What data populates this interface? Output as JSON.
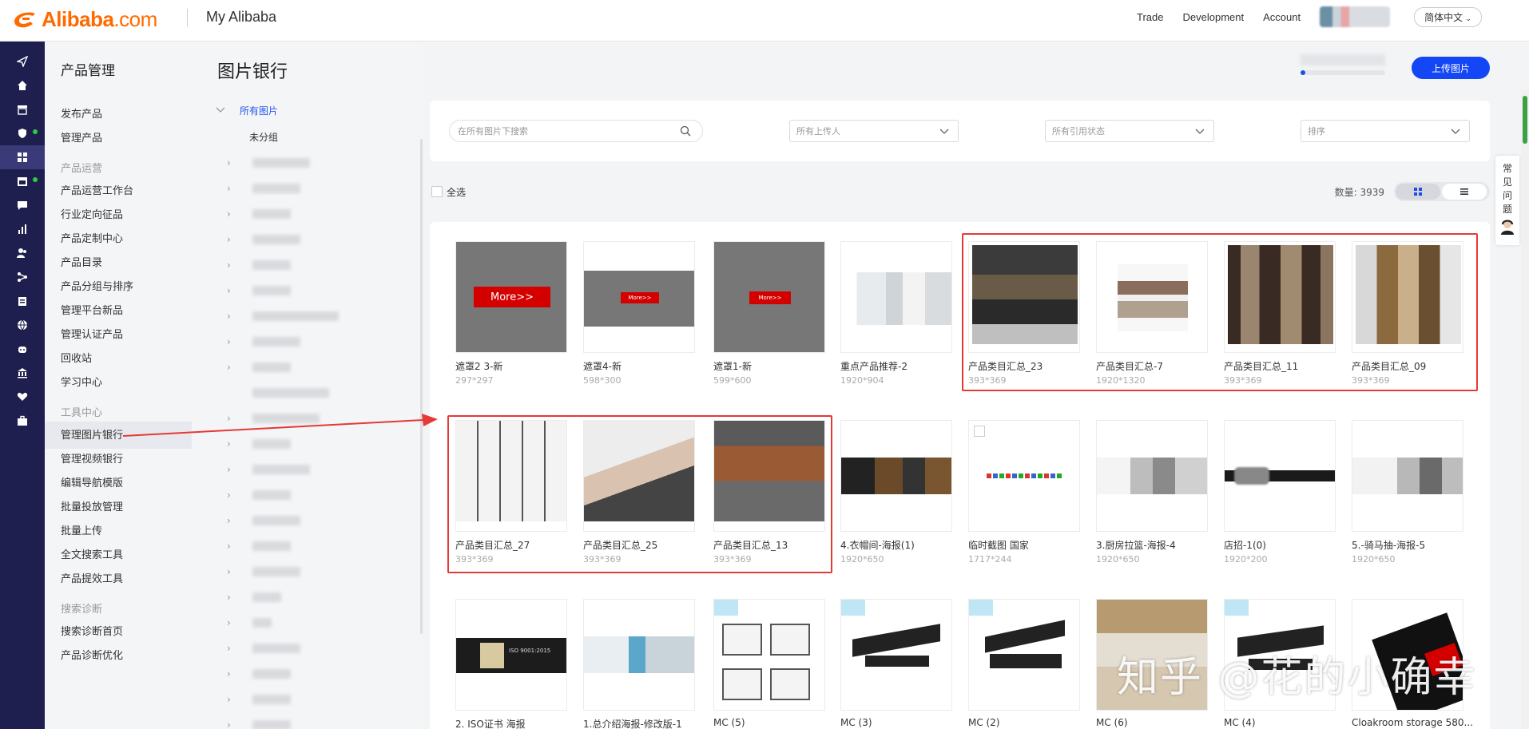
{
  "header": {
    "logo_text": "Alibaba",
    "logo_suffix": ".com",
    "app_title": "My Alibaba",
    "nav": [
      "Trade",
      "Development",
      "Account"
    ],
    "language": "简体中文"
  },
  "rail_icons": [
    "send-icon",
    "home-icon",
    "store-icon",
    "shield-icon",
    "grid-icon",
    "calendar-icon",
    "chat-icon",
    "chart-icon",
    "users-icon",
    "flow-icon",
    "clipboard-icon",
    "globe-icon",
    "robot-icon",
    "bank-icon",
    "heart-icon",
    "briefcase-icon"
  ],
  "sidebar": {
    "title": "产品管理",
    "items1": [
      "发布产品",
      "管理产品"
    ],
    "section2": "产品运营",
    "items2": [
      "产品运营工作台",
      "行业定向征品",
      "产品定制中心",
      "产品目录",
      "产品分组与排序",
      "管理平台新品",
      "管理认证产品",
      "回收站",
      "学习中心"
    ],
    "section3": "工具中心",
    "items3": [
      "管理图片银行",
      "管理视频银行",
      "编辑导航模版",
      "批量投放管理",
      "批量上传",
      "全文搜索工具",
      "产品提效工具"
    ],
    "section4": "搜索诊断",
    "items4": [
      "搜索诊断首页",
      "产品诊断优化"
    ]
  },
  "page": {
    "title": "图片银行",
    "upload_button": "上传图片",
    "upload_progress": 0.05
  },
  "tree": {
    "root": "所有图片",
    "ungrouped": "未分组"
  },
  "filters": {
    "search_placeholder": "在所有图片下搜索",
    "uploader": "所有上传人",
    "reference_status": "所有引用状态",
    "sort": "排序"
  },
  "bulk": {
    "select_all": "全选",
    "count_text": "数量: 3939"
  },
  "images": [
    {
      "name": "遮罩2 3-新",
      "size": "297*297"
    },
    {
      "name": "遮罩4-新",
      "size": "598*300"
    },
    {
      "name": "遮罩1-新",
      "size": "599*600"
    },
    {
      "name": "重点产品推荐-2",
      "size": "1920*904"
    },
    {
      "name": "产品类目汇总_23",
      "size": "393*369"
    },
    {
      "name": "产品类目汇总-7",
      "size": "1920*1320"
    },
    {
      "name": "产品类目汇总_11",
      "size": "393*369"
    },
    {
      "name": "产品类目汇总_09",
      "size": "393*369"
    },
    {
      "name": "产品类目汇总_27",
      "size": "393*369"
    },
    {
      "name": "产品类目汇总_25",
      "size": "393*369"
    },
    {
      "name": "产品类目汇总_13",
      "size": "393*369"
    },
    {
      "name": "4.衣帽间-海报(1)",
      "size": "1920*650"
    },
    {
      "name": "临时截图 国家",
      "size": "1717*244"
    },
    {
      "name": "3.厨房拉篮-海报-4",
      "size": "1920*650"
    },
    {
      "name": "店招-1(0)",
      "size": "1920*200"
    },
    {
      "name": "5.-骑马抽-海报-5",
      "size": "1920*650"
    },
    {
      "name": "2. ISO证书 海报",
      "size": ""
    },
    {
      "name": "1.总介绍海报-修改版-1",
      "size": ""
    },
    {
      "name": "MC (5)",
      "size": ""
    },
    {
      "name": "MC (3)",
      "size": ""
    },
    {
      "name": "MC (2)",
      "size": ""
    },
    {
      "name": "MC (6)",
      "size": ""
    },
    {
      "name": "MC (4)",
      "size": ""
    },
    {
      "name": "Cloakroom storage 580...",
      "size": ""
    }
  ],
  "thumb_texts": {
    "more_big": "More>>",
    "more_small": "More>>",
    "iso": "ISO 9001:2015"
  },
  "faq": "常见问题",
  "watermark": "知乎 @花的小确幸",
  "colors": {
    "brand": "#ff6a00",
    "primary": "#1346f5",
    "rail": "#1f1f4f",
    "highlight": "#e53935"
  }
}
